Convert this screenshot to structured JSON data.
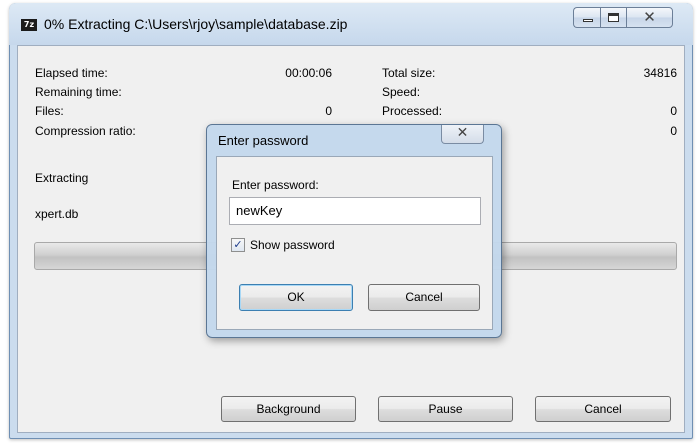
{
  "window": {
    "app_icon_text": "7z",
    "title": "0% Extracting C:\\Users\\rjoy\\sample\\database.zip",
    "close_glyph": "✕"
  },
  "stats": {
    "elapsed_label": "Elapsed time:",
    "elapsed_value": "00:00:06",
    "remaining_label": "Remaining time:",
    "files_label": "Files:",
    "files_value": "0",
    "compression_label": "Compression ratio:",
    "total_size_label": "Total size:",
    "total_size_value": "34816",
    "speed_label": "Speed:",
    "processed_label": "Processed:",
    "processed_value": "0",
    "compressed_value": "0"
  },
  "operation": {
    "status": "Extracting",
    "current_file": "xpert.db",
    "progress_percent": 0
  },
  "buttons": {
    "background": "Background",
    "pause": "Pause",
    "cancel": "Cancel"
  },
  "password_dialog": {
    "title": "Enter password",
    "close_glyph": "✕",
    "field_label": "Enter password:",
    "password_value": "newKey",
    "show_password_label": "Show password",
    "show_password_checked": true,
    "check_glyph": "✓",
    "ok_label": "OK",
    "cancel_label": "Cancel"
  },
  "colors": {
    "window_frame": "#cbdcee",
    "client_bg": "#f0f0f0",
    "default_button_border": "#3c7fb1"
  }
}
